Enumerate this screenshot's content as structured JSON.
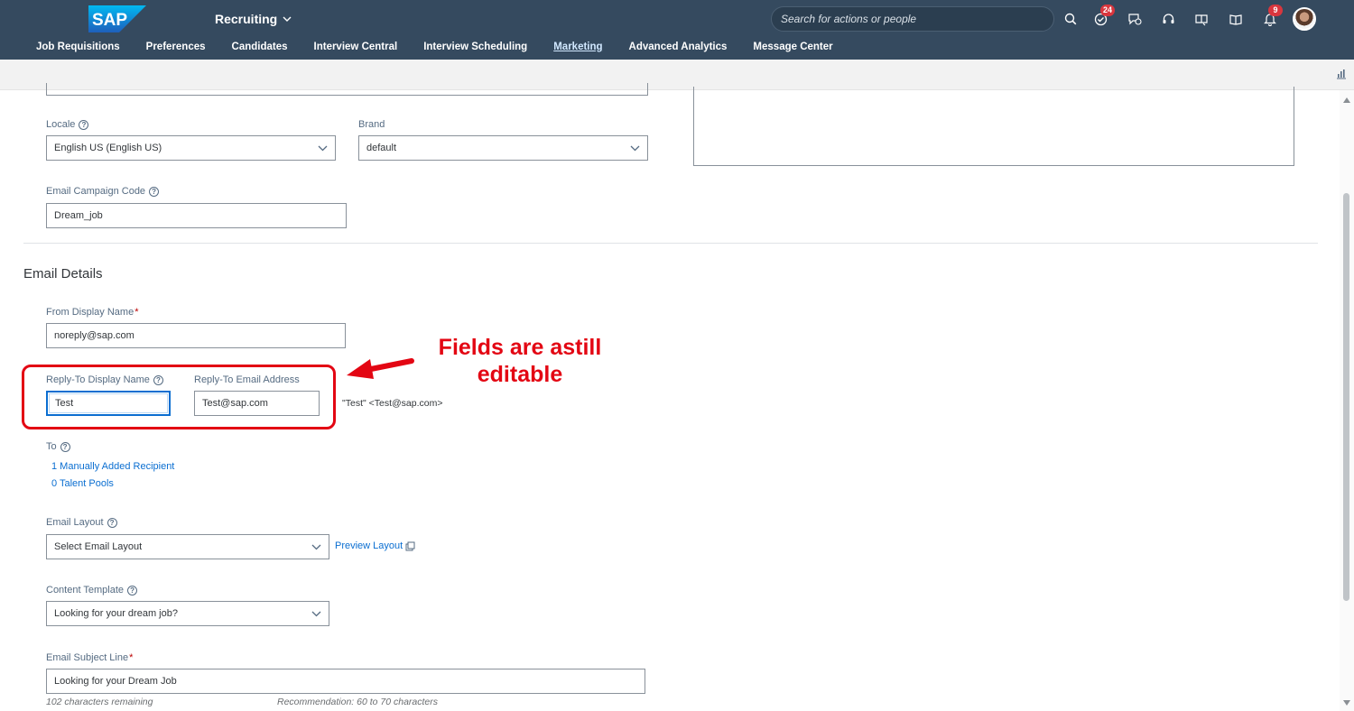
{
  "shell": {
    "logo_text": "SAP",
    "product": "Recruiting",
    "search_placeholder": "Search for actions or people",
    "todo_badge": "24",
    "notif_badge": "9"
  },
  "nav": [
    {
      "label": "Job Requisitions"
    },
    {
      "label": "Preferences"
    },
    {
      "label": "Candidates"
    },
    {
      "label": "Interview Central"
    },
    {
      "label": "Interview Scheduling"
    },
    {
      "label": "Marketing",
      "active": true
    },
    {
      "label": "Advanced Analytics"
    },
    {
      "label": "Message Center"
    }
  ],
  "form": {
    "locale_label": "Locale",
    "locale_value": "English US (English US)",
    "brand_label": "Brand",
    "brand_value": "default",
    "campaign_label": "Email Campaign Code",
    "campaign_value": "Dream_job",
    "section_title": "Email Details",
    "from_label": "From Display Name",
    "from_value": "noreply@sap.com",
    "reply_name_label": "Reply-To Display Name",
    "reply_name_value": "Test",
    "reply_email_label": "Reply-To Email Address",
    "reply_email_value": "Test@sap.com",
    "reply_preview": "\"Test\" <Test@sap.com>",
    "to_label": "To",
    "recipients_link": "1 Manually Added Recipient",
    "talent_pools_link": "0 Talent Pools",
    "layout_label": "Email Layout",
    "layout_value": "Select Email Layout",
    "preview_layout": "Preview Layout",
    "template_label": "Content Template",
    "template_value": "Looking for your dream job?",
    "subject_label": "Email Subject Line",
    "subject_value": "Looking for your Dream Job",
    "chars_remaining": "102 characters remaining",
    "recommendation": "Recommendation: 60 to 70 characters",
    "required_mark": "*",
    "help_glyph": "?"
  },
  "annotation": {
    "line1": "Fields are astill",
    "line2": "editable"
  },
  "colors": {
    "shell": "#354a5f",
    "accent": "#0a6ed1",
    "annotation": "#e30613"
  }
}
